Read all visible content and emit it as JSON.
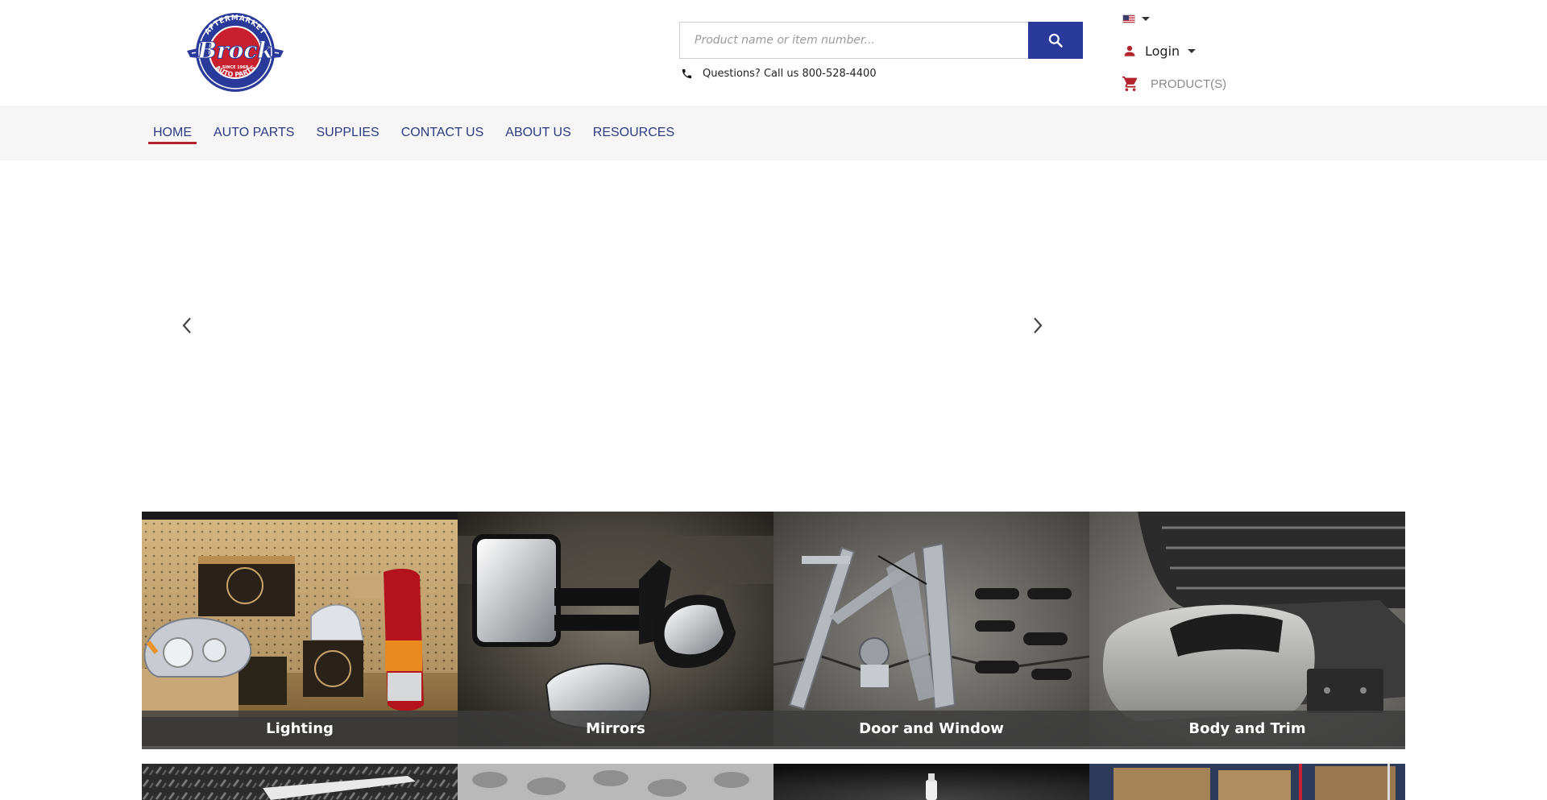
{
  "header": {
    "logo_text": "Brock",
    "logo_arc_top": "AFTERMARKET",
    "logo_arc_bottom": "AUTO PARTS",
    "logo_since": "SINCE 1968",
    "search": {
      "placeholder": "Product name or item number..."
    },
    "phone_text": "Questions? Call us 800-528-4400",
    "login_label": "Login",
    "cart_label": "PRODUCT(S)"
  },
  "nav": {
    "items": [
      {
        "label": "HOME",
        "active": true
      },
      {
        "label": "AUTO PARTS"
      },
      {
        "label": "SUPPLIES"
      },
      {
        "label": "CONTACT US"
      },
      {
        "label": "ABOUT US"
      },
      {
        "label": "RESOURCES"
      }
    ]
  },
  "categories": [
    {
      "label": "Lighting",
      "icon": "headlight-taillight-image"
    },
    {
      "label": "Mirrors",
      "icon": "side-mirrors-image"
    },
    {
      "label": "Door and Window",
      "icon": "window-regulator-image"
    },
    {
      "label": "Body and Trim",
      "icon": "grille-bumper-image"
    }
  ],
  "colors": {
    "brand_blue": "#2a3a9a",
    "nav_text": "#2d3a82",
    "active_underline": "#b3252e",
    "logo_red": "#c8202f"
  }
}
